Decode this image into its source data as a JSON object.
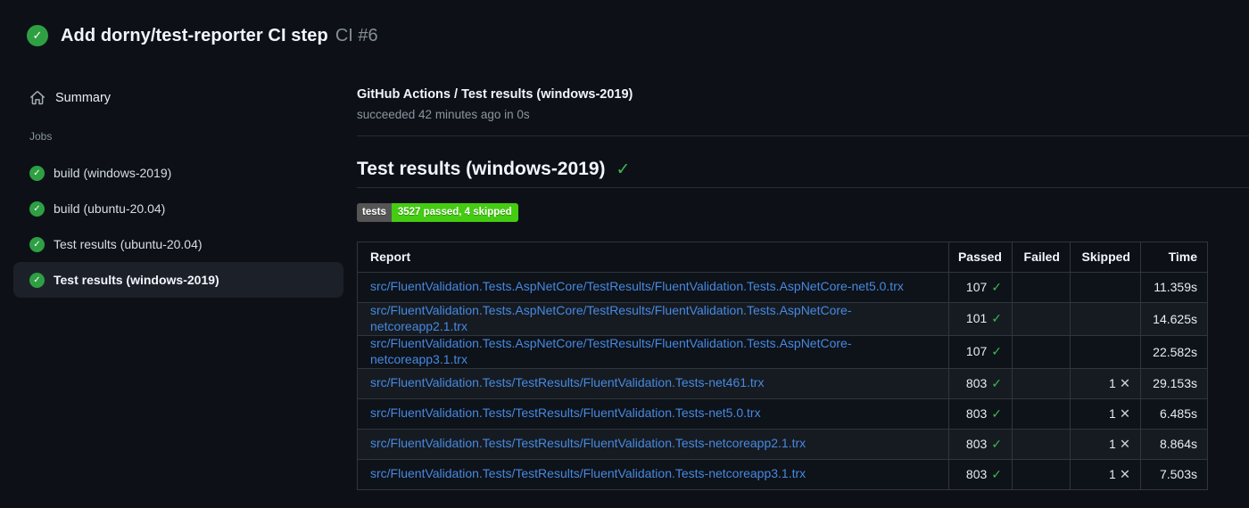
{
  "header": {
    "title": "Add dorny/test-reporter CI step",
    "run_number": "CI #6",
    "status": "success"
  },
  "sidebar": {
    "summary_label": "Summary",
    "jobs_label": "Jobs",
    "jobs": [
      {
        "label": "build (windows-2019)",
        "status": "success",
        "selected": false
      },
      {
        "label": "build (ubuntu-20.04)",
        "status": "success",
        "selected": false
      },
      {
        "label": "Test results (ubuntu-20.04)",
        "status": "success",
        "selected": false
      },
      {
        "label": "Test results (windows-2019)",
        "status": "success",
        "selected": true
      }
    ]
  },
  "main": {
    "check_title": "GitHub Actions / Test results (windows-2019)",
    "check_status_line": "succeeded 42 minutes ago in 0s",
    "section_title": "Test results (windows-2019)",
    "section_status": "success",
    "badge": {
      "label": "tests",
      "value": "3527 passed, 4 skipped"
    },
    "table": {
      "headers": [
        "Report",
        "Passed",
        "Failed",
        "Skipped",
        "Time"
      ],
      "rows": [
        {
          "report": "src/FluentValidation.Tests.AspNetCore/TestResults/FluentValidation.Tests.AspNetCore-net5.0.trx",
          "passed": "107",
          "failed": "",
          "skipped": "",
          "time": "11.359s"
        },
        {
          "report": "src/FluentValidation.Tests.AspNetCore/TestResults/FluentValidation.Tests.AspNetCore-netcoreapp2.1.trx",
          "passed": "101",
          "failed": "",
          "skipped": "",
          "time": "14.625s"
        },
        {
          "report": "src/FluentValidation.Tests.AspNetCore/TestResults/FluentValidation.Tests.AspNetCore-netcoreapp3.1.trx",
          "passed": "107",
          "failed": "",
          "skipped": "",
          "time": "22.582s"
        },
        {
          "report": "src/FluentValidation.Tests/TestResults/FluentValidation.Tests-net461.trx",
          "passed": "803",
          "failed": "",
          "skipped": "1",
          "time": "29.153s"
        },
        {
          "report": "src/FluentValidation.Tests/TestResults/FluentValidation.Tests-net5.0.trx",
          "passed": "803",
          "failed": "",
          "skipped": "1",
          "time": "6.485s"
        },
        {
          "report": "src/FluentValidation.Tests/TestResults/FluentValidation.Tests-netcoreapp2.1.trx",
          "passed": "803",
          "failed": "",
          "skipped": "1",
          "time": "8.864s"
        },
        {
          "report": "src/FluentValidation.Tests/TestResults/FluentValidation.Tests-netcoreapp3.1.trx",
          "passed": "803",
          "failed": "",
          "skipped": "1",
          "time": "7.503s"
        }
      ]
    }
  },
  "icons": {
    "success": "check-circle-icon",
    "passed_mark": "check-icon",
    "skipped_mark": "x-icon",
    "summary": "home-icon"
  },
  "colors": {
    "page_bg": "#0d1117",
    "success_green": "#2ea043",
    "check_green": "#3fb950",
    "link_blue": "#4689e0",
    "badge_label_bg": "#555555",
    "badge_value_bg": "#44cc11",
    "x_gray": "#c9d1d9",
    "selected_item_bg": "#1c2129"
  }
}
